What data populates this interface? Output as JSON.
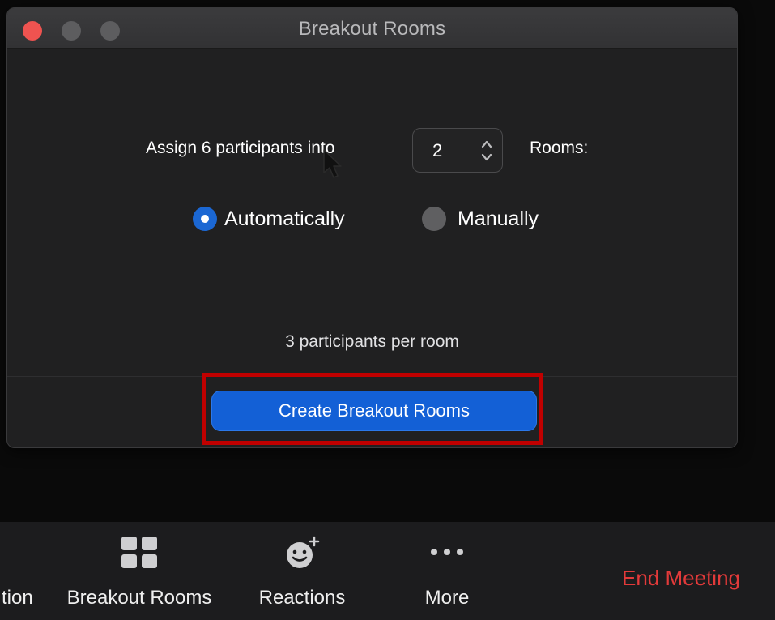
{
  "dialog": {
    "title": "Breakout Rooms",
    "assign_prefix": "Assign 6 participants into",
    "rooms_count": "2",
    "rooms_suffix": "Rooms:",
    "options": {
      "automatic_label": "Automatically",
      "manual_label": "Manually",
      "selected": "Automatically"
    },
    "per_room_text": "3 participants per room",
    "create_button_label": "Create Breakout Rooms"
  },
  "toolbar": {
    "partial_item_label": "tion",
    "breakout_label": "Breakout Rooms",
    "reactions_label": "Reactions",
    "more_label": "More",
    "end_meeting_label": "End Meeting",
    "icons": {
      "breakout": "grid-icon",
      "reactions": "smiley-plus-icon",
      "more": "ellipsis-icon"
    }
  },
  "colors": {
    "accent_blue": "#1360d6",
    "highlight_red": "#c00000",
    "end_meeting_red": "#e23a3a",
    "close_button_red": "#ef5350"
  }
}
